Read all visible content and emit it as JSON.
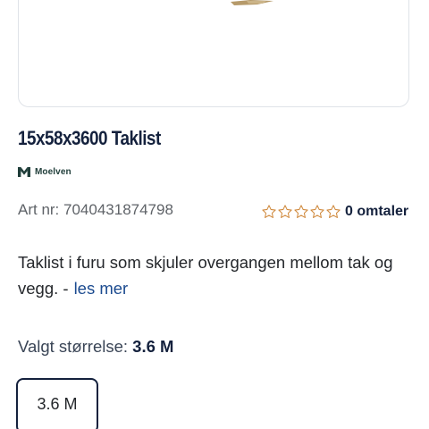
{
  "product": {
    "title": "15x58x3600 Taklist",
    "brand": "Moelven",
    "article_number": "Art nr: 7040431874798",
    "rating": {
      "stars": 0,
      "max_stars": 5,
      "reviews_label": "0 omtaler"
    },
    "description": "Taklist i furu som skjuler overgangen mellom tak og vegg. -",
    "read_more_label": "les mer"
  },
  "size_selector": {
    "label": "Valgt størrelse:",
    "selected_value": "3.6 M",
    "options": [
      "3.6 M"
    ]
  },
  "colors": {
    "title": "#14213d",
    "link": "#1b4a8f",
    "star_outline": "#d08a3e",
    "brand": "#1f3d39"
  },
  "icons": {
    "brand_logo": "moelven-logo-icon",
    "star": "star-outline-icon"
  }
}
